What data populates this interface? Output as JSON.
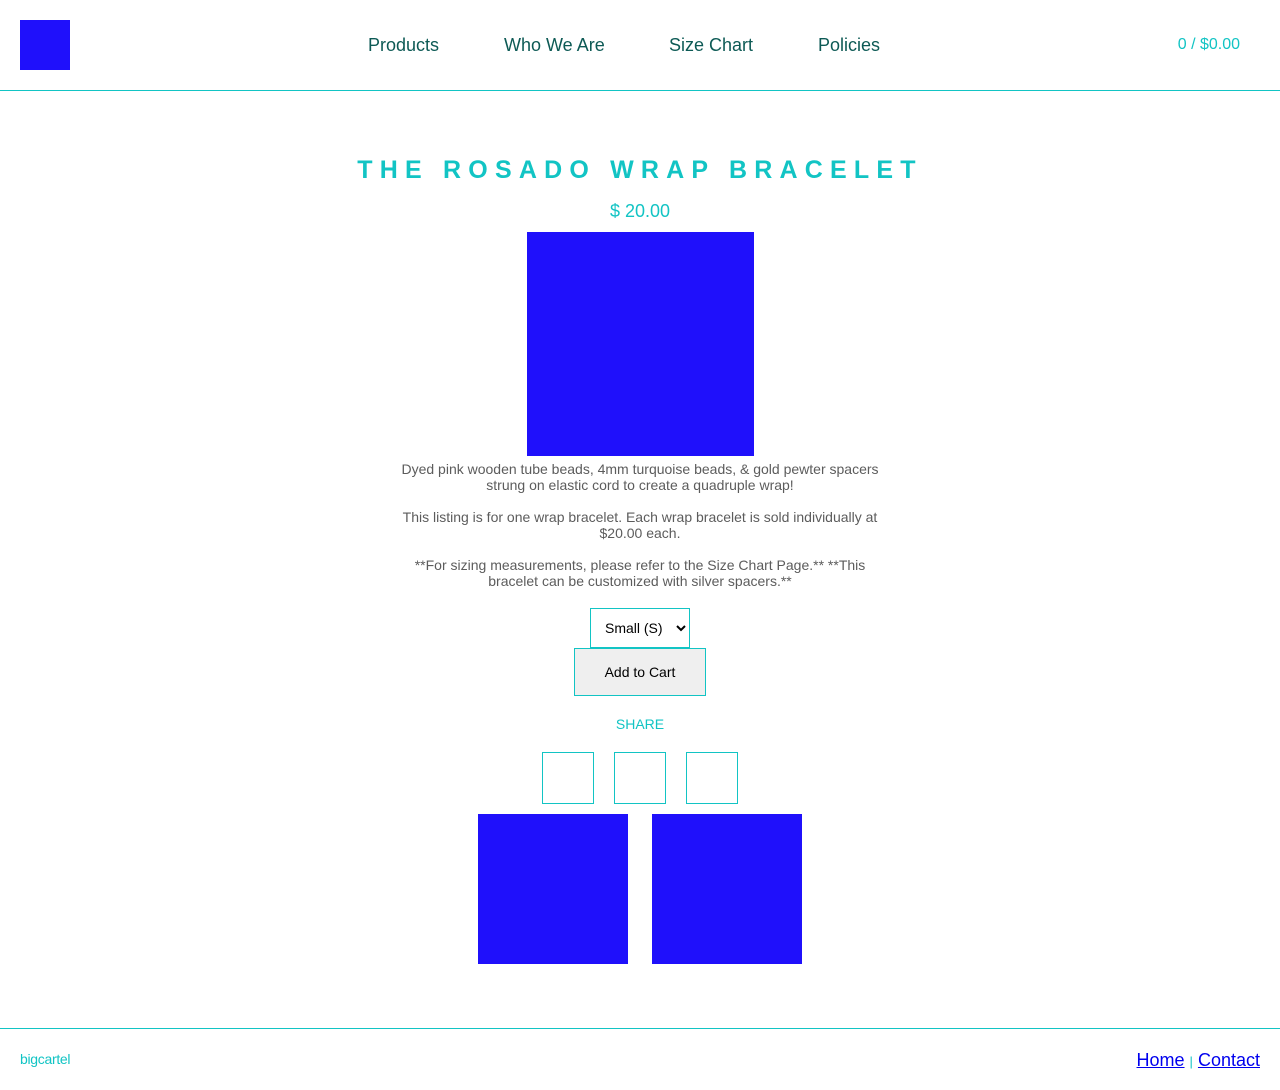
{
  "header": {
    "nav": [
      "Products",
      "Who We Are",
      "Size Chart",
      "Policies"
    ],
    "cart": "0 / $0.00"
  },
  "product": {
    "title": "THE ROSADO WRAP BRACELET",
    "price": "$ 20.00",
    "description": [
      "Dyed pink wooden tube beads, 4mm turquoise beads, & gold pewter spacers strung on elastic cord to create a quadruple wrap!",
      "This listing is for one wrap bracelet. Each wrap bracelet is sold individually at $20.00 each.",
      "**For sizing measurements, please refer to the Size Chart Page.** **This bracelet can be customized with silver spacers.**"
    ],
    "size_selected": "Small (S)",
    "add_to_cart": "Add to Cart",
    "share_label": "SHARE"
  },
  "footer": {
    "credit": "bigcartel",
    "links": [
      "Home",
      "Contact"
    ],
    "separator": "|"
  },
  "colors": {
    "accent": "#12c4c4",
    "nav_text": "#0d5a55",
    "image_placeholder": "#1f10fb",
    "link": "#0000ee"
  }
}
